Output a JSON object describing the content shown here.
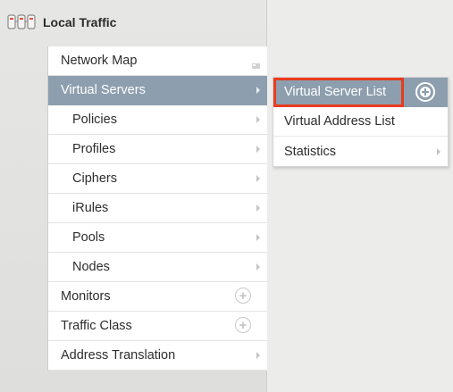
{
  "header": {
    "title": "Local Traffic",
    "icon": "local-traffic-icon"
  },
  "menu": {
    "items": [
      {
        "label": "Network Map",
        "indicator": "map-icon"
      },
      {
        "label": "Virtual Servers",
        "indicator": "chevron-right-icon",
        "active": true
      },
      {
        "label": "Policies",
        "indicator": "chevron-right-icon"
      },
      {
        "label": "Profiles",
        "indicator": "chevron-right-icon"
      },
      {
        "label": "Ciphers",
        "indicator": "chevron-right-icon"
      },
      {
        "label": "iRules",
        "indicator": "chevron-right-icon"
      },
      {
        "label": "Pools",
        "indicator": "chevron-right-icon"
      },
      {
        "label": "Nodes",
        "indicator": "chevron-right-icon"
      },
      {
        "label": "Monitors",
        "indicator": "plus-circle-icon"
      },
      {
        "label": "Traffic Class",
        "indicator": "plus-circle-icon"
      },
      {
        "label": "Address Translation",
        "indicator": "chevron-right-icon"
      }
    ]
  },
  "submenu": {
    "items": [
      {
        "label": "Virtual Server List",
        "active": true,
        "highlighted": true,
        "indicator": "plus-circle-icon"
      },
      {
        "label": "Virtual Address List"
      },
      {
        "label": "Statistics",
        "indicator": "chevron-right-icon"
      }
    ]
  },
  "colors": {
    "active_bg": "#8d9eae",
    "highlight_border": "#ea3a1f",
    "sidebar_bg": "#e6e6e4"
  }
}
